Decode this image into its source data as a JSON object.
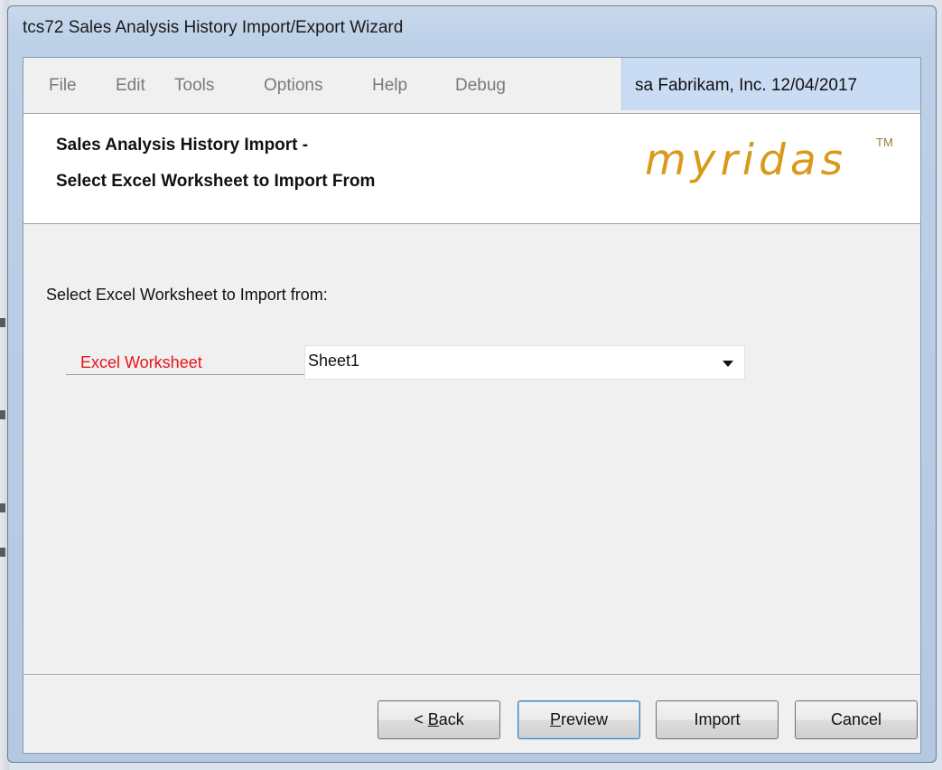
{
  "window": {
    "title": "tcs72 Sales Analysis History Import/Export Wizard"
  },
  "menu": {
    "items": [
      {
        "label": "File"
      },
      {
        "label": "Edit"
      },
      {
        "label": "Tools"
      },
      {
        "label": "Options"
      },
      {
        "label": "Help"
      },
      {
        "label": "Debug"
      }
    ]
  },
  "status": {
    "user": "sa",
    "company": "Fabrikam, Inc.",
    "date": "12/04/2017",
    "text": "sa  Fabrikam, Inc.  12/04/2017"
  },
  "header": {
    "line1": "Sales Analysis History Import -",
    "line2": "Select Excel Worksheet to Import From",
    "logo": "myridas",
    "trademark": "TM",
    "logo_color": "#d99a1a"
  },
  "body": {
    "prompt": "Select Excel Worksheet to Import from:",
    "field_label": "Excel Worksheet",
    "field_label_color": "#e8141b",
    "worksheet_value": "Sheet1"
  },
  "buttons": {
    "back": {
      "label": "< Back",
      "prefix": "< ",
      "mnemonic": "B",
      "rest": "ack"
    },
    "preview": {
      "label": "Preview",
      "prefix": "",
      "mnemonic": "P",
      "rest": "review"
    },
    "import": {
      "label": "Import"
    },
    "cancel": {
      "label": "Cancel"
    }
  }
}
